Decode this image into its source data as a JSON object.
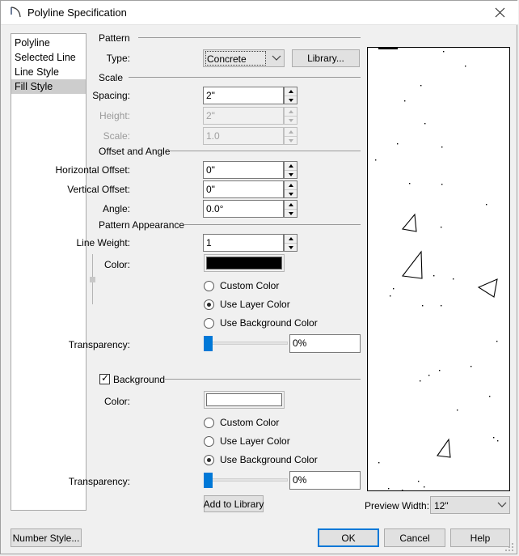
{
  "window": {
    "title": "Polyline Specification",
    "icon": "polyline-icon",
    "close_label": "✕"
  },
  "sidebar": {
    "items": [
      {
        "label": "Polyline",
        "selected": false
      },
      {
        "label": "Selected Line",
        "selected": false
      },
      {
        "label": "Line Style",
        "selected": false
      },
      {
        "label": "Fill Style",
        "selected": true
      }
    ]
  },
  "pattern": {
    "group_label": "Pattern",
    "type_label": "Type:",
    "type_value": "Concrete",
    "library_button": "Library..."
  },
  "scale": {
    "group_label": "Scale",
    "spacing_label": "Spacing:",
    "spacing_value": "2\"",
    "height_label": "Height:",
    "height_value": "2\"",
    "scale_label": "Scale:",
    "scale_value": "1.0"
  },
  "offset_angle": {
    "group_label": "Offset and Angle",
    "horizontal_label": "Horizontal Offset:",
    "horizontal_value": "0\"",
    "vertical_label": "Vertical Offset:",
    "vertical_value": "0\"",
    "angle_label": "Angle:",
    "angle_value": "0.0°"
  },
  "pattern_appearance": {
    "group_label": "Pattern Appearance",
    "line_weight_label": "Line Weight:",
    "line_weight_value": "1",
    "color_label": "Color:",
    "color_value": "#000000",
    "radio_custom": "Custom Color",
    "radio_layer": "Use Layer Color",
    "radio_background": "Use Background Color",
    "selected_radio": "Use Layer Color",
    "transparency_label": "Transparency:",
    "transparency_value": "0%",
    "transparency_percent": 0
  },
  "background": {
    "group_label": "Background",
    "checked": true,
    "color_label": "Color:",
    "color_value": "#ffffff",
    "radio_custom": "Custom Color",
    "radio_layer": "Use Layer Color",
    "radio_background": "Use Background Color",
    "selected_radio": "Use Background Color",
    "transparency_label": "Transparency:",
    "transparency_value": "0%",
    "transparency_percent": 0,
    "add_to_library_button": "Add to Library"
  },
  "preview": {
    "width_label": "Preview Width:",
    "width_value": "12\""
  },
  "footer": {
    "number_style_button": "Number Style...",
    "ok_button": "OK",
    "cancel_button": "Cancel",
    "help_button": "Help"
  },
  "colors": {
    "accent": "#0078d7",
    "dialog_bg": "#f0f0f0",
    "selection": "#cdcdcd"
  }
}
